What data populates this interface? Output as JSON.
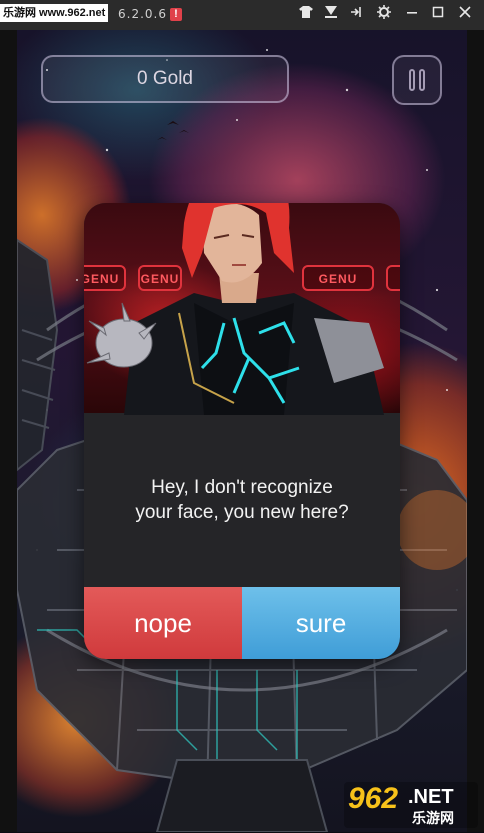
{
  "titlebar": {
    "site_badge": "乐游网 www.962.net",
    "version": "6.2.0.6",
    "alert": "!",
    "buttons": [
      "shirt",
      "keyboard",
      "pin",
      "settings",
      "minimize",
      "maximize",
      "close"
    ]
  },
  "hud": {
    "gold_label": "0 Gold"
  },
  "dialog": {
    "tags": [
      "GENU",
      "GENU",
      "GENU"
    ],
    "message_line1": "Hey, I don't recognize",
    "message_line2": "your face, you new here?",
    "nope_label": "nope",
    "sure_label": "sure",
    "nope_color": "#d9474a",
    "sure_color": "#54ade0"
  },
  "watermark": {
    "number": "962",
    "suffix": ".NET",
    "cn": "乐游网"
  }
}
